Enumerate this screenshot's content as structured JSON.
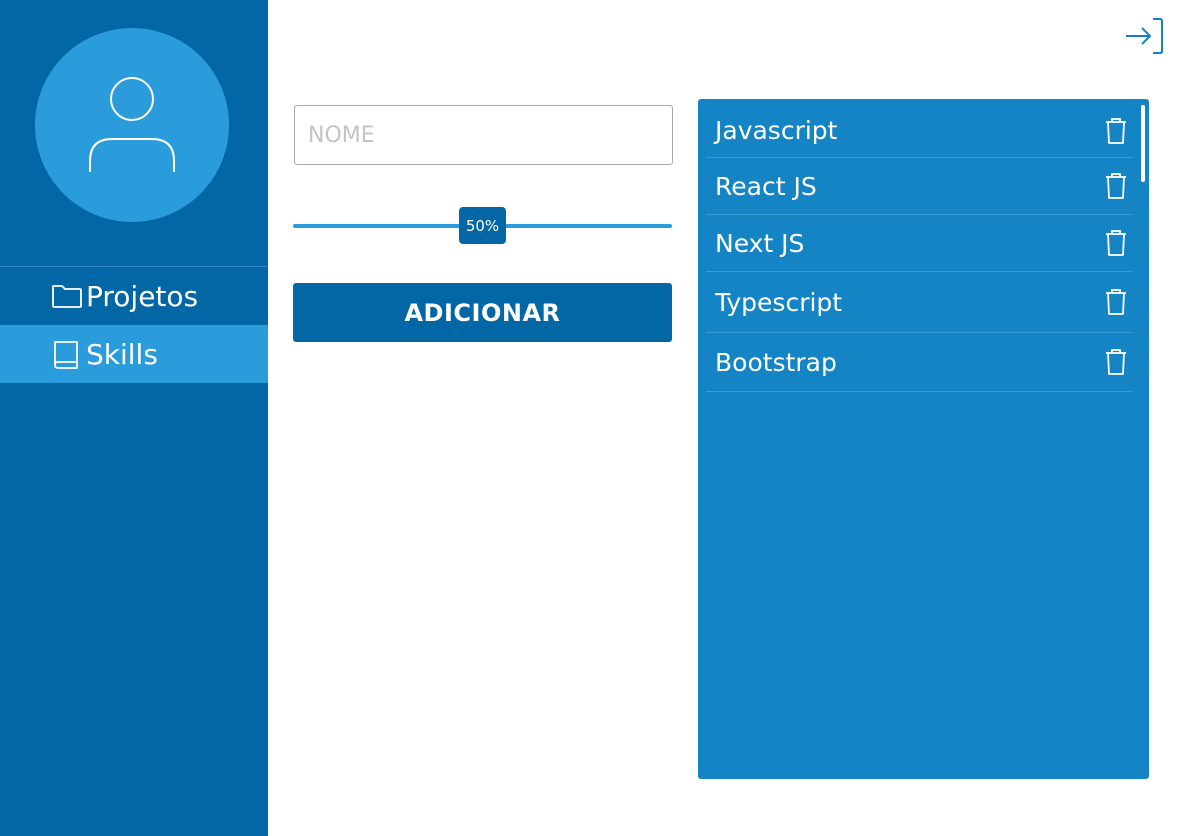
{
  "sidebar": {
    "avatar_icon": "user-icon",
    "items": [
      {
        "label": "Projetos",
        "icon": "folder-icon",
        "active": false
      },
      {
        "label": "Skills",
        "icon": "book-icon",
        "active": true
      }
    ]
  },
  "header": {
    "logout_icon": "logout-icon"
  },
  "form": {
    "name_placeholder": "NOME",
    "name_value": "",
    "level_label": "50%",
    "level_fraction": 0.5,
    "add_button_label": "ADICIONAR"
  },
  "skills": {
    "items": [
      {
        "label": "Javascript",
        "icon": "trash-icon"
      },
      {
        "label": "React JS",
        "icon": "trash-icon"
      },
      {
        "label": "Next JS",
        "icon": "trash-icon"
      },
      {
        "label": "Typescript",
        "icon": "trash-icon"
      },
      {
        "label": "Bootstrap",
        "icon": "trash-icon"
      }
    ]
  },
  "colors": {
    "sidebar_bg": "#0367a6",
    "accent_light": "#2a9bdb",
    "panel_bg": "#1484c4",
    "button_bg": "#0367a6",
    "text_on_dark": "#ffffff"
  }
}
